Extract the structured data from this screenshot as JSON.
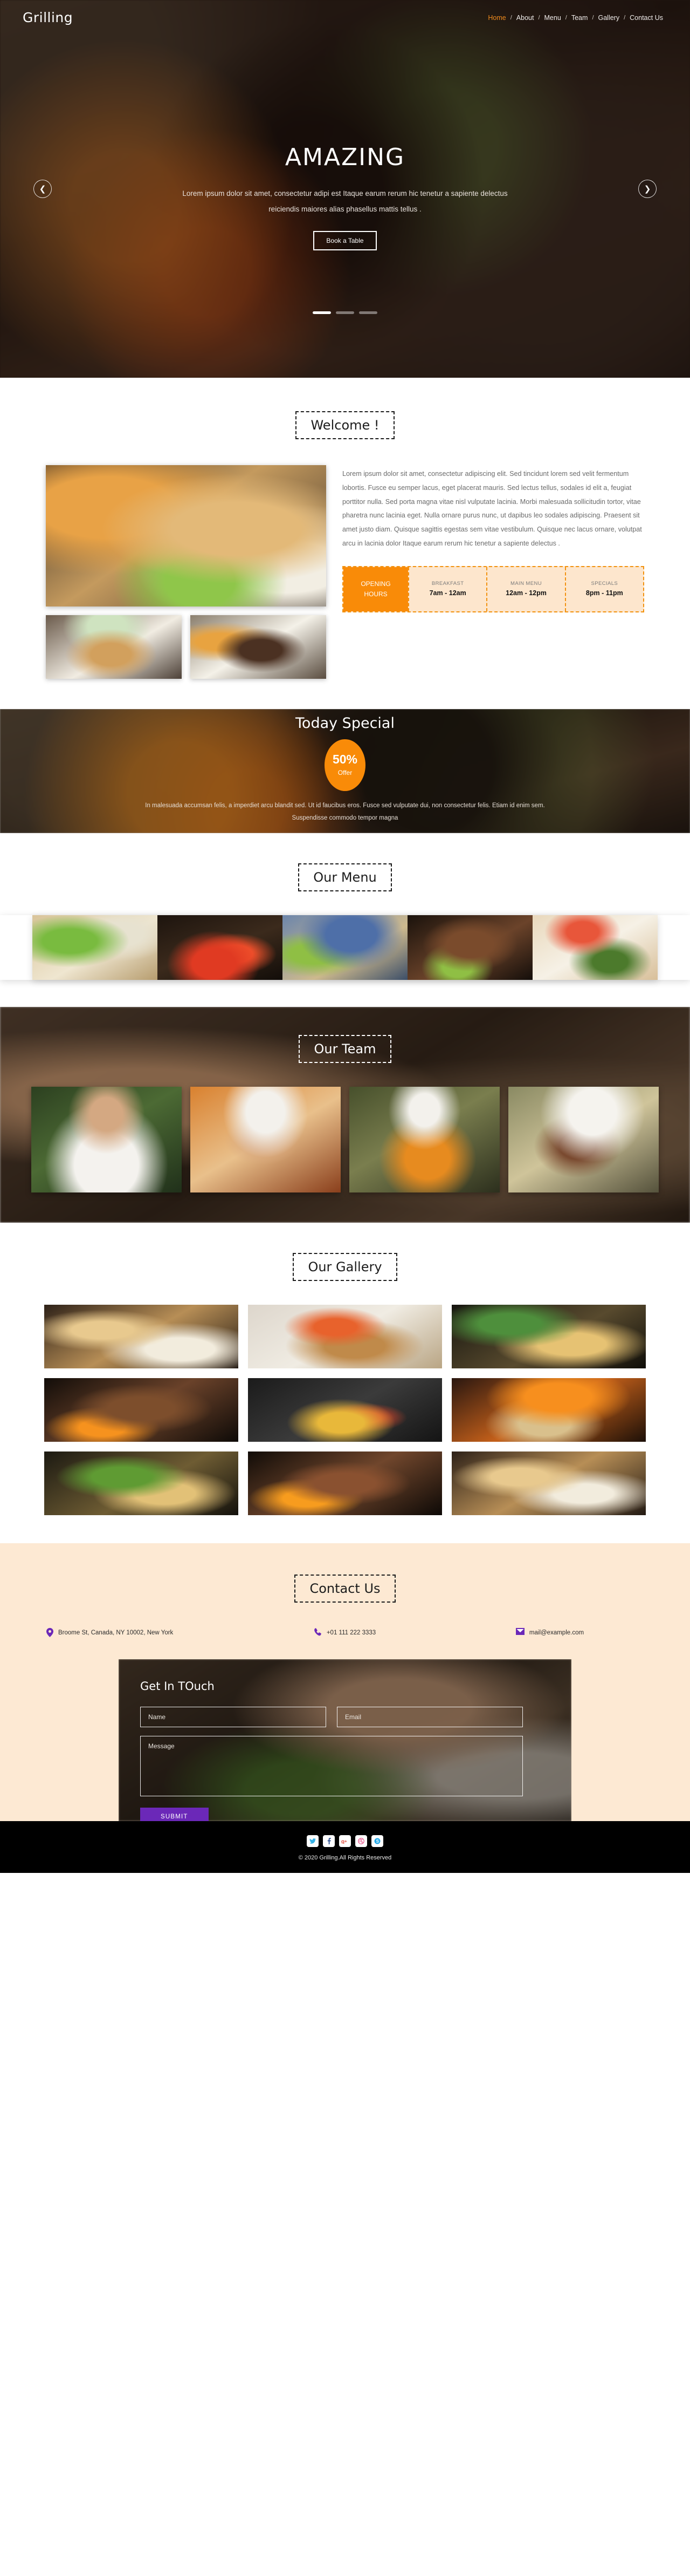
{
  "brand": "Grilling",
  "nav": {
    "separator": "/",
    "items": [
      {
        "label": "Home",
        "active": true
      },
      {
        "label": "About",
        "active": false
      },
      {
        "label": "Menu",
        "active": false
      },
      {
        "label": "Team",
        "active": false
      },
      {
        "label": "Gallery",
        "active": false
      },
      {
        "label": "Contact Us",
        "active": false
      }
    ]
  },
  "hero": {
    "title": "AMAZING",
    "subtitle": "Lorem ipsum dolor sit amet, consectetur adipi est Itaque earum rerum hic tenetur a sapiente delectus reiciendis maiores alias phasellus mattis tellus .",
    "button": "Book a Table",
    "prev_icon": "chevron-left-icon",
    "next_icon": "chevron-right-icon",
    "slides": 3,
    "active_slide": 1
  },
  "welcome": {
    "title": "Welcome !",
    "paragraph": "Lorem ipsum dolor sit amet, consectetur adipiscing elit. Sed tincidunt lorem sed velit fermentum lobortis. Fusce eu semper lacus, eget placerat mauris. Sed lectus tellus, sodales id elit a, feugiat porttitor nulla. Sed porta magna vitae nisl vulputate lacinia. Morbi malesuada sollicitudin tortor, vitae pharetra nunc lacinia eget. Nulla ornare purus nunc, ut dapibus leo sodales adipiscing. Praesent sit amet justo diam. Quisque sagittis egestas sem vitae vestibulum. Quisque nec lacus ornare, volutpat arcu in lacinia dolor Itaque earum rerum hic tenetur a sapiente delectus ."
  },
  "hours": {
    "label_line1": "OPENING",
    "label_line2": "HOURS",
    "cells": [
      {
        "name": "BREAKFAST",
        "time": "7am - 12am"
      },
      {
        "name": "MAIN MENU",
        "time": "12am - 12pm"
      },
      {
        "name": "SPECIALS",
        "time": "8pm - 11pm"
      }
    ]
  },
  "special": {
    "title": "Today Special",
    "badge_percent": "50%",
    "badge_label": "Offer",
    "paragraph": "In malesuada accumsan felis, a imperdiet arcu blandit sed. Ut id faucibus eros. Fusce sed vulputate dui, non consectetur felis. Etiam id enim sem. Suspendisse commodo tempor magna"
  },
  "menu": {
    "title": "Our Menu",
    "items": [
      {
        "alt": "noodle-salad-bowl"
      },
      {
        "alt": "tomato-skewers"
      },
      {
        "alt": "grill-tongs-outdoors"
      },
      {
        "alt": "bacon-wrapped-skewers"
      },
      {
        "alt": "sauce-bowl-plated-dish"
      }
    ]
  },
  "team": {
    "title": "Our Team",
    "members": [
      {
        "alt": "executive-chef-portrait"
      },
      {
        "alt": "pastry-chef-plating"
      },
      {
        "alt": "chef-waving-apron"
      },
      {
        "alt": "chef-in-white-hat"
      }
    ]
  },
  "gallery": {
    "title": "Our Gallery",
    "items": [
      {
        "alt": "burgers-and-fries-plates"
      },
      {
        "alt": "grilled-meat-platter"
      },
      {
        "alt": "loaded-cheese-pizza-slice"
      },
      {
        "alt": "skewers-on-open-grill"
      },
      {
        "alt": "vegetable-kebabs-on-grill"
      },
      {
        "alt": "flame-grilled-meat"
      },
      {
        "alt": "herb-garnished-dish"
      },
      {
        "alt": "skewers-over-flames"
      },
      {
        "alt": "burger-plates-closeup"
      }
    ]
  },
  "contact": {
    "title": "Contact Us",
    "details": [
      {
        "icon": "map-pin-icon",
        "text": "Broome St, Canada, NY 10002, New York"
      },
      {
        "icon": "phone-icon",
        "text": "+01 111 222 3333"
      },
      {
        "icon": "envelope-icon",
        "text": "mail@example.com"
      }
    ]
  },
  "form": {
    "heading": "Get In TOuch",
    "name_placeholder": "Name",
    "name_value": "",
    "email_placeholder": "Email",
    "email_value": "",
    "message_placeholder": "Message",
    "message_value": "",
    "submit_label": "SUBMIT"
  },
  "footer": {
    "socials": [
      {
        "name": "twitter-icon",
        "glyph": "⬤"
      },
      {
        "name": "facebook-icon",
        "glyph": "f"
      },
      {
        "name": "google-plus-icon",
        "glyph": "g+"
      },
      {
        "name": "dribbble-icon",
        "glyph": "●"
      },
      {
        "name": "skype-icon",
        "glyph": "s"
      }
    ],
    "copyright": "© 2020 Grilling.All Rights Reserved"
  },
  "colors": {
    "accent_orange": "#f98b08",
    "accent_purple": "#6b28b8",
    "cream": "#fde9d3",
    "nav_active": "#f08a1d"
  }
}
